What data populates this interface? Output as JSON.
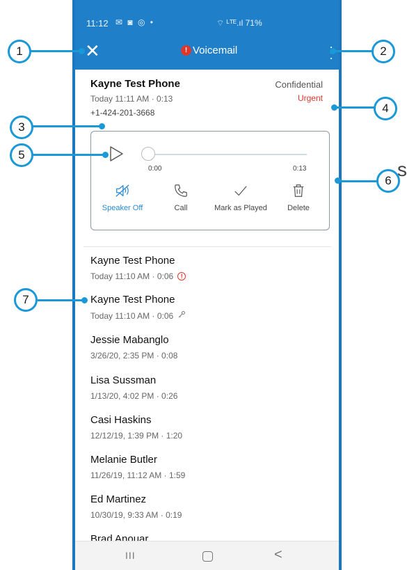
{
  "status_bar": {
    "time": "11:12",
    "icons": "✉ ◙ ◎ •",
    "right": "⌔ ᴸᵀᴱ.ıl 71%"
  },
  "app_bar": {
    "badge_count": "!",
    "title": "Voicemail"
  },
  "detail": {
    "caller": "Kayne Test Phone",
    "meta": "Today 11:11 AM · 0:13",
    "phone_number": "+1-424-201-3668",
    "confidential_label": "Confidential",
    "urgent_label": "Urgent"
  },
  "player": {
    "time_start": "0:00",
    "time_end": "0:13",
    "progress": 0,
    "actions": [
      {
        "label": "Speaker Off"
      },
      {
        "label": "Call"
      },
      {
        "label": "Mark as Played"
      },
      {
        "label": "Delete"
      }
    ]
  },
  "voicemails": [
    {
      "name": "Kayne Test Phone",
      "sub": "Today 11:10 AM · 0:06",
      "marker": "urgent"
    },
    {
      "name": "Kayne Test Phone",
      "sub": "Today 11:10 AM · 0:06",
      "marker": "key"
    },
    {
      "name": "Jessie Mabanglo",
      "sub": "3/26/20, 2:35 PM · 0:08"
    },
    {
      "name": "Lisa Sussman",
      "sub": "1/13/20, 4:02 PM · 0:26"
    },
    {
      "name": "Casi Haskins",
      "sub": "12/12/19, 1:39 PM · 1:20"
    },
    {
      "name": "Melanie Butler",
      "sub": "11/26/19, 11:12 AM · 1:59"
    },
    {
      "name": "Ed Martinez",
      "sub": "10/30/19, 9:33 AM · 0:19"
    },
    {
      "name": "Brad Anouar",
      "sub": ""
    }
  ],
  "navbar": {
    "recents_glyph": "III",
    "back_glyph": "<"
  },
  "callouts": [
    "1",
    "2",
    "3",
    "4",
    "5",
    "6",
    "7"
  ],
  "stray_text": "s",
  "colors": {
    "app_bar": "#1f7fc8",
    "accent": "#1a98d8",
    "urgent": "#e0362b",
    "speaker_active": "#2a8ad0"
  }
}
